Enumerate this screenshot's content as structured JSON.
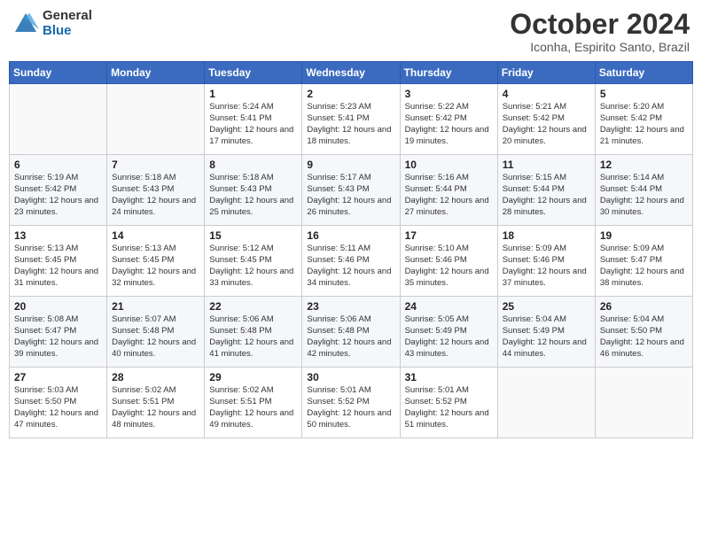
{
  "header": {
    "logo_general": "General",
    "logo_blue": "Blue",
    "month_title": "October 2024",
    "subtitle": "Iconha, Espirito Santo, Brazil"
  },
  "weekdays": [
    "Sunday",
    "Monday",
    "Tuesday",
    "Wednesday",
    "Thursday",
    "Friday",
    "Saturday"
  ],
  "weeks": [
    [
      {
        "day": "",
        "sunrise": "",
        "sunset": "",
        "daylight": ""
      },
      {
        "day": "",
        "sunrise": "",
        "sunset": "",
        "daylight": ""
      },
      {
        "day": "1",
        "sunrise": "Sunrise: 5:24 AM",
        "sunset": "Sunset: 5:41 PM",
        "daylight": "Daylight: 12 hours and 17 minutes."
      },
      {
        "day": "2",
        "sunrise": "Sunrise: 5:23 AM",
        "sunset": "Sunset: 5:41 PM",
        "daylight": "Daylight: 12 hours and 18 minutes."
      },
      {
        "day": "3",
        "sunrise": "Sunrise: 5:22 AM",
        "sunset": "Sunset: 5:42 PM",
        "daylight": "Daylight: 12 hours and 19 minutes."
      },
      {
        "day": "4",
        "sunrise": "Sunrise: 5:21 AM",
        "sunset": "Sunset: 5:42 PM",
        "daylight": "Daylight: 12 hours and 20 minutes."
      },
      {
        "day": "5",
        "sunrise": "Sunrise: 5:20 AM",
        "sunset": "Sunset: 5:42 PM",
        "daylight": "Daylight: 12 hours and 21 minutes."
      }
    ],
    [
      {
        "day": "6",
        "sunrise": "Sunrise: 5:19 AM",
        "sunset": "Sunset: 5:42 PM",
        "daylight": "Daylight: 12 hours and 23 minutes."
      },
      {
        "day": "7",
        "sunrise": "Sunrise: 5:18 AM",
        "sunset": "Sunset: 5:43 PM",
        "daylight": "Daylight: 12 hours and 24 minutes."
      },
      {
        "day": "8",
        "sunrise": "Sunrise: 5:18 AM",
        "sunset": "Sunset: 5:43 PM",
        "daylight": "Daylight: 12 hours and 25 minutes."
      },
      {
        "day": "9",
        "sunrise": "Sunrise: 5:17 AM",
        "sunset": "Sunset: 5:43 PM",
        "daylight": "Daylight: 12 hours and 26 minutes."
      },
      {
        "day": "10",
        "sunrise": "Sunrise: 5:16 AM",
        "sunset": "Sunset: 5:44 PM",
        "daylight": "Daylight: 12 hours and 27 minutes."
      },
      {
        "day": "11",
        "sunrise": "Sunrise: 5:15 AM",
        "sunset": "Sunset: 5:44 PM",
        "daylight": "Daylight: 12 hours and 28 minutes."
      },
      {
        "day": "12",
        "sunrise": "Sunrise: 5:14 AM",
        "sunset": "Sunset: 5:44 PM",
        "daylight": "Daylight: 12 hours and 30 minutes."
      }
    ],
    [
      {
        "day": "13",
        "sunrise": "Sunrise: 5:13 AM",
        "sunset": "Sunset: 5:45 PM",
        "daylight": "Daylight: 12 hours and 31 minutes."
      },
      {
        "day": "14",
        "sunrise": "Sunrise: 5:13 AM",
        "sunset": "Sunset: 5:45 PM",
        "daylight": "Daylight: 12 hours and 32 minutes."
      },
      {
        "day": "15",
        "sunrise": "Sunrise: 5:12 AM",
        "sunset": "Sunset: 5:45 PM",
        "daylight": "Daylight: 12 hours and 33 minutes."
      },
      {
        "day": "16",
        "sunrise": "Sunrise: 5:11 AM",
        "sunset": "Sunset: 5:46 PM",
        "daylight": "Daylight: 12 hours and 34 minutes."
      },
      {
        "day": "17",
        "sunrise": "Sunrise: 5:10 AM",
        "sunset": "Sunset: 5:46 PM",
        "daylight": "Daylight: 12 hours and 35 minutes."
      },
      {
        "day": "18",
        "sunrise": "Sunrise: 5:09 AM",
        "sunset": "Sunset: 5:46 PM",
        "daylight": "Daylight: 12 hours and 37 minutes."
      },
      {
        "day": "19",
        "sunrise": "Sunrise: 5:09 AM",
        "sunset": "Sunset: 5:47 PM",
        "daylight": "Daylight: 12 hours and 38 minutes."
      }
    ],
    [
      {
        "day": "20",
        "sunrise": "Sunrise: 5:08 AM",
        "sunset": "Sunset: 5:47 PM",
        "daylight": "Daylight: 12 hours and 39 minutes."
      },
      {
        "day": "21",
        "sunrise": "Sunrise: 5:07 AM",
        "sunset": "Sunset: 5:48 PM",
        "daylight": "Daylight: 12 hours and 40 minutes."
      },
      {
        "day": "22",
        "sunrise": "Sunrise: 5:06 AM",
        "sunset": "Sunset: 5:48 PM",
        "daylight": "Daylight: 12 hours and 41 minutes."
      },
      {
        "day": "23",
        "sunrise": "Sunrise: 5:06 AM",
        "sunset": "Sunset: 5:48 PM",
        "daylight": "Daylight: 12 hours and 42 minutes."
      },
      {
        "day": "24",
        "sunrise": "Sunrise: 5:05 AM",
        "sunset": "Sunset: 5:49 PM",
        "daylight": "Daylight: 12 hours and 43 minutes."
      },
      {
        "day": "25",
        "sunrise": "Sunrise: 5:04 AM",
        "sunset": "Sunset: 5:49 PM",
        "daylight": "Daylight: 12 hours and 44 minutes."
      },
      {
        "day": "26",
        "sunrise": "Sunrise: 5:04 AM",
        "sunset": "Sunset: 5:50 PM",
        "daylight": "Daylight: 12 hours and 46 minutes."
      }
    ],
    [
      {
        "day": "27",
        "sunrise": "Sunrise: 5:03 AM",
        "sunset": "Sunset: 5:50 PM",
        "daylight": "Daylight: 12 hours and 47 minutes."
      },
      {
        "day": "28",
        "sunrise": "Sunrise: 5:02 AM",
        "sunset": "Sunset: 5:51 PM",
        "daylight": "Daylight: 12 hours and 48 minutes."
      },
      {
        "day": "29",
        "sunrise": "Sunrise: 5:02 AM",
        "sunset": "Sunset: 5:51 PM",
        "daylight": "Daylight: 12 hours and 49 minutes."
      },
      {
        "day": "30",
        "sunrise": "Sunrise: 5:01 AM",
        "sunset": "Sunset: 5:52 PM",
        "daylight": "Daylight: 12 hours and 50 minutes."
      },
      {
        "day": "31",
        "sunrise": "Sunrise: 5:01 AM",
        "sunset": "Sunset: 5:52 PM",
        "daylight": "Daylight: 12 hours and 51 minutes."
      },
      {
        "day": "",
        "sunrise": "",
        "sunset": "",
        "daylight": ""
      },
      {
        "day": "",
        "sunrise": "",
        "sunset": "",
        "daylight": ""
      }
    ]
  ]
}
